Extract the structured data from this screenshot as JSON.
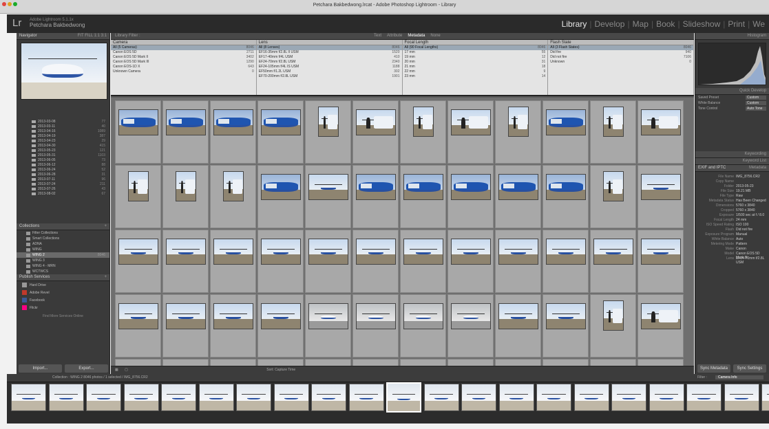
{
  "window_title": "Petchara Bakbedwong.lrcat - Adobe Photoshop Lightroom - Library",
  "app": {
    "logo": "Lr",
    "subtitle": "Adobe Lightroom 5.1.1x",
    "user": "Petchara Bakbedwong"
  },
  "modules": [
    "Library",
    "Develop",
    "Map",
    "Book",
    "Slideshow",
    "Print",
    "We"
  ],
  "active_module": "Library",
  "left": {
    "navigator_label": "Navigator",
    "navigator_zoom": "FIT  FILL  1:1  3:1",
    "folders": [
      {
        "name": "2013-03-08",
        "count": "77"
      },
      {
        "name": "2013-03-11",
        "count": "40"
      },
      {
        "name": "2013-04-16",
        "count": "1089"
      },
      {
        "name": "2013-04-19",
        "count": "387"
      },
      {
        "name": "2013-04-23",
        "count": "29"
      },
      {
        "name": "2013-04-30",
        "count": "415"
      },
      {
        "name": "2013-05-23",
        "count": "121"
      },
      {
        "name": "2013-05-31",
        "count": "1103"
      },
      {
        "name": "2013-06-05",
        "count": "73"
      },
      {
        "name": "2013-06-12",
        "count": "88"
      },
      {
        "name": "2013-06-24",
        "count": "52"
      },
      {
        "name": "2013-06-28",
        "count": "31"
      },
      {
        "name": "2013-07-11",
        "count": "96"
      },
      {
        "name": "2013-07-24",
        "count": "211"
      },
      {
        "name": "2013-07-26",
        "count": "43"
      },
      {
        "name": "2013-08-02",
        "count": "67"
      }
    ],
    "collections_label": "Collections",
    "collections": [
      {
        "name": "Filter Collections",
        "count": ""
      },
      {
        "name": "Smart Collections",
        "count": ""
      },
      {
        "name": "ADNA",
        "count": ""
      },
      {
        "name": "WING",
        "count": ""
      },
      {
        "name": "WING 2",
        "count": "8046",
        "selected": true
      },
      {
        "name": "WING 3",
        "count": ""
      },
      {
        "name": "WING 4 - MRN",
        "count": ""
      },
      {
        "name": "WCTWCS",
        "count": ""
      }
    ],
    "publish_label": "Publish Services",
    "services": [
      {
        "name": "Hard Drive",
        "color": "#999999"
      },
      {
        "name": "Adobe Revel",
        "color": "#c0392b"
      },
      {
        "name": "Facebook",
        "color": "#3b5998"
      },
      {
        "name": "Flickr",
        "color": "#ff0084"
      }
    ],
    "find_more": "Find More Services Online",
    "import_label": "Import...",
    "export_label": "Export..."
  },
  "center": {
    "filter_label": "Library Filter :",
    "filter_tabs": [
      "Text",
      "Attribute",
      "Metadata",
      "None"
    ],
    "active_filter": "Metadata",
    "metadata_columns": [
      {
        "header": "Camera",
        "rows": [
          {
            "label": "All (5 Cameras)",
            "count": "8046",
            "selected": true
          },
          {
            "label": "Canon EOS 5D",
            "count": "2711"
          },
          {
            "label": "Canon EOS 5D Mark II",
            "count": "3402"
          },
          {
            "label": "Canon EOS 5D Mark III",
            "count": "1290"
          },
          {
            "label": "Canon EOS-1D X",
            "count": "643"
          },
          {
            "label": "Unknown Camera",
            "count": "0"
          }
        ]
      },
      {
        "header": "Lens",
        "rows": [
          {
            "label": "All (8 Lenses)",
            "count": "8046",
            "selected": true
          },
          {
            "label": "EF16-35mm f/2.8L II USM",
            "count": "1520"
          },
          {
            "label": "EF17-40mm f/4L USM",
            "count": "410"
          },
          {
            "label": "EF24-70mm f/2.8L USM",
            "count": "2340"
          },
          {
            "label": "EF24-105mm f/4L IS USM",
            "count": "1188"
          },
          {
            "label": "EF50mm f/1.2L USM",
            "count": "302"
          },
          {
            "label": "EF70-200mm f/2.8L USM",
            "count": "1901"
          }
        ]
      },
      {
        "header": "Focal Length",
        "rows": [
          {
            "label": "All (90 Focal Lengths)",
            "count": "8046",
            "selected": true
          },
          {
            "label": "17 mm",
            "count": "55"
          },
          {
            "label": "19 mm",
            "count": "12"
          },
          {
            "label": "20 mm",
            "count": "31"
          },
          {
            "label": "21 mm",
            "count": "18"
          },
          {
            "label": "22 mm",
            "count": "9"
          },
          {
            "label": "23 mm",
            "count": "14"
          }
        ]
      },
      {
        "header": "Flash State",
        "rows": [
          {
            "label": "All (3 Flash States)",
            "count": "8046",
            "selected": true
          },
          {
            "label": "Did fire",
            "count": "940"
          },
          {
            "label": "Did not fire",
            "count": "7106"
          },
          {
            "label": "Unknown",
            "count": "0"
          }
        ]
      }
    ],
    "grid_rows": [
      [
        "close",
        "close",
        "close",
        "close",
        "person",
        "person",
        "person",
        "person",
        "person",
        "close",
        "person",
        "person"
      ],
      [
        "person",
        "person",
        "person",
        "close",
        "heli",
        "close",
        "close",
        "close",
        "close",
        "close",
        "person",
        "heli"
      ],
      [
        "heli",
        "heli",
        "heli",
        "heli",
        "heli",
        "heli",
        "heli",
        "heli",
        "heli",
        "heli",
        "heli",
        "heli"
      ],
      [
        "heli",
        "heli",
        "heli",
        "heli",
        "hangar",
        "hangar",
        "hangar",
        "hangar",
        "heli",
        "heli",
        "person",
        "person"
      ],
      [
        "heli",
        "heli",
        "heli",
        "heli",
        "heli",
        "heli",
        "heli",
        "heli",
        "heli",
        "heli",
        "heli",
        "heli"
      ]
    ],
    "cell_prefix": "IMG_",
    "toolbar_text": "Sort: Capture Time"
  },
  "right": {
    "histogram_label": "Histogram",
    "quick_develop_label": "Quick Develop",
    "qd_rows": [
      {
        "label": "Saved Preset",
        "value": "Custom"
      },
      {
        "label": "White Balance",
        "value": "Custom"
      },
      {
        "label": "Tone Control",
        "value": "Auto Tone"
      }
    ],
    "keywording_label": "Keywording",
    "keyword_list_label": "Keyword List",
    "metadata_label": "Metadata",
    "metadata_preset": "EXIF and IPTC",
    "metadata_rows": [
      {
        "label": "File Name",
        "value": "IMG_8756.CR2"
      },
      {
        "label": "Copy Name",
        "value": ""
      },
      {
        "label": "Folder",
        "value": "2013-05-23"
      },
      {
        "label": "File Size",
        "value": "19.21 MB"
      },
      {
        "label": "File Type",
        "value": "Raw"
      },
      {
        "label": "Metadata Status",
        "value": "Has Been Changed"
      },
      {
        "label": "Dimensions",
        "value": "5760 x 3840"
      },
      {
        "label": "Cropped",
        "value": "5760 x 3840"
      },
      {
        "label": "Exposure",
        "value": "1/500 sec at f / 8.0"
      },
      {
        "label": "Focal Length",
        "value": "24 mm"
      },
      {
        "label": "ISO Speed Rating",
        "value": "ISO 100"
      },
      {
        "label": "Flash",
        "value": "Did not fire"
      },
      {
        "label": "Exposure Program",
        "value": "Manual"
      },
      {
        "label": "White Balance",
        "value": "Auto"
      },
      {
        "label": "Metering Mode",
        "value": "Pattern"
      },
      {
        "label": "Make",
        "value": "Canon"
      },
      {
        "label": "Model",
        "value": "Canon EOS 5D Mark III"
      },
      {
        "label": "Lens",
        "value": "EF24-70mm f/2.8L USM"
      }
    ],
    "sync_metadata": "Sync Metadata",
    "sync_settings": "Sync Settings"
  },
  "filmstrip": {
    "breadcrumb": "Collection : WING 2   8046 photos / 1 selected / IMG_8756.CR2",
    "filter_label": "Filter :",
    "filter_value": "Camera Info",
    "count": 21,
    "current_index": 10
  }
}
